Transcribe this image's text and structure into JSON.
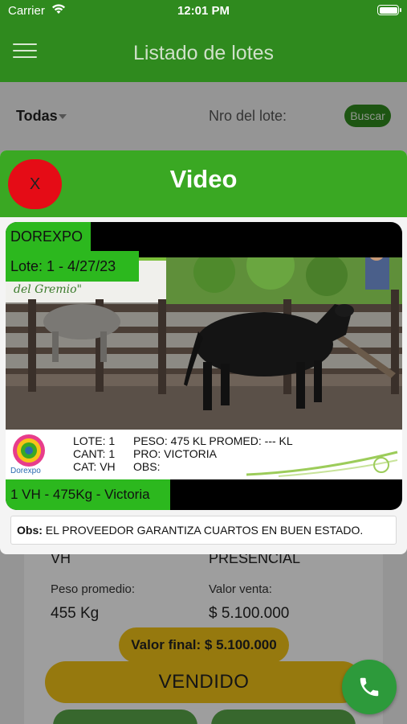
{
  "status_bar": {
    "carrier": "Carrier",
    "time": "12:01 PM"
  },
  "nav": {
    "title": "Listado de lotes"
  },
  "filters": {
    "selected": "Todas",
    "lote_label": "Nro del lote:",
    "search_button": "Buscar"
  },
  "card": {
    "type_value": "VH",
    "modality_value": "PRESENCIAL",
    "peso_label": "Peso promedio:",
    "peso_value": "455 Kg",
    "valor_label": "Valor venta:",
    "valor_value": "$ 5.100.000",
    "valor_final": "Valor final: $ 5.100.000",
    "status_button": "VENDIDO"
  },
  "modal": {
    "close_label": "X",
    "title": "Video",
    "video": {
      "company": "DOREXPO",
      "lote_date": "Lote: 1 - 4/27/23",
      "banner_text": "del Gremio\"",
      "logo_text": "Dorexpo",
      "lote": "LOTE: 1",
      "cant": "CANT: 1",
      "cat": "CAT: VH",
      "peso": "PESO: 475 KL PROMED: --- KL",
      "pro": "PRO: VICTORIA",
      "obs": "OBS:",
      "summary": "1 VH - 475Kg - Victoria"
    },
    "obs_label": "Obs:",
    "obs_text": "EL PROVEEDOR GARANTIZA CUARTOS EN BUEN ESTADO."
  },
  "icons": [
    "wifi-icon",
    "battery-icon",
    "hamburger-icon",
    "chevron-down-icon",
    "phone-icon"
  ],
  "colors": {
    "primary_green": "#2f8a1e",
    "modal_green": "#3aa823",
    "close_red": "#e50c16",
    "yellow": "#f2c418"
  }
}
